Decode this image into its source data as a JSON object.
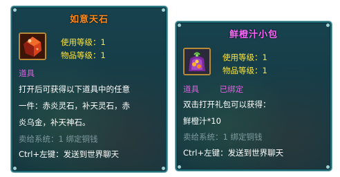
{
  "tooltip1": {
    "title": "如意天石",
    "stat_use_level": "使用等级：1",
    "stat_item_level": "物品等级：1",
    "category": "道具",
    "description_lines": [
      "打开后可获得以下道具中的任意",
      "一件：赤炎灵石，补天灵石，赤",
      "炎乌金，补天神石。"
    ],
    "sell_info": "卖给系统：1 绑定铜钱",
    "hint": "Ctrl+左键：发送到世界聊天"
  },
  "tooltip2": {
    "title": "鲜橙汁小包",
    "stat_use_level": "使用等级：1",
    "stat_item_level": "物品等级：1",
    "category": "道具",
    "bound_status": "已绑定",
    "description_lines": [
      "双击打开礼包可以获得：",
      "鲜橙汁*10"
    ],
    "sell_info": "卖给系统：1 绑定铜钱",
    "hint": "Ctrl+左键：发送到世界聊天"
  }
}
